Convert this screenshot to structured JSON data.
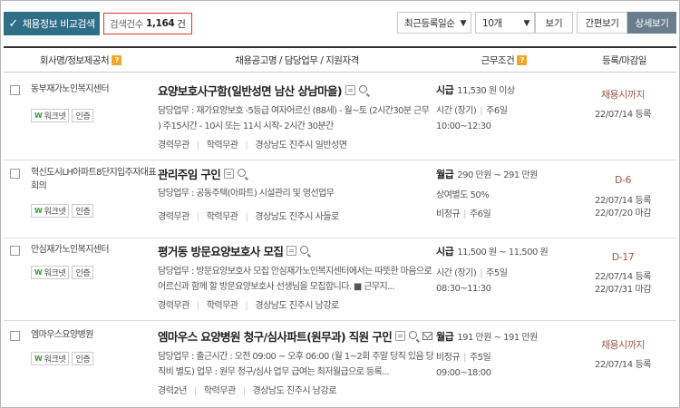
{
  "toolbar": {
    "compare_label": "채용정보 비교검색",
    "count_label": "검색건수",
    "count_value": "1,164",
    "count_unit": "건",
    "sort_select": "최근등록일순",
    "size_select": "10개",
    "view_label": "보기",
    "mode_simple": "간편보기",
    "mode_detail": "상세보기"
  },
  "header": {
    "company": "회사명/정보제공처",
    "title": "채용공고명 / 담당업무 / 지원자격",
    "conditions": "근무조건",
    "date": "등록/마감일"
  },
  "rows": [
    {
      "company": "동부재가노인복지센터",
      "badges": [
        "워크넷",
        "인증"
      ],
      "title": "요양보호사구함(일반성면 남산 상남마을)",
      "desc": "담당업무 : 재가요양보호 -5등급 여자어르신 (88세) - 월~토 (2시간30분 근무 ) 주15시간 - 10시 또는 11시 시작- 2시간 30분간",
      "meta": [
        "경력무관",
        "학력무관",
        "경상남도 진주시 일반성면"
      ],
      "pay_type": "시급",
      "pay_range": "11,530 원 이상",
      "cond_line2a": "시간 (장기)",
      "cond_line2b": "주6일",
      "cond_line3": "10:00~12:30",
      "deadline": "채용시까지",
      "reg": "22/07/14 등록"
    },
    {
      "company": "혁신도시LH아파트8단지입주자대표회의",
      "badges": [
        "워크넷",
        "인증"
      ],
      "title": "관리주임 구인",
      "desc": "담당업무 : 공동주택(아파트) 시설관리 및 영선업무",
      "meta": [
        "경력무관",
        "학력무관",
        "경상남도 진주시 사들로"
      ],
      "pay_type": "월급",
      "pay_range": "290 만원 ~ 291 만원",
      "cond_line2a": "상여별도 50%",
      "cond_line3a": "비정규",
      "cond_line3b": "주6일",
      "deadline": "D-6",
      "reg": "22/07/14 등록",
      "close": "22/07/20 마감"
    },
    {
      "company": "안심재가노인복지센터",
      "badges": [
        "워크넷",
        "인증"
      ],
      "title": "평거동 방문요양보호사 모집",
      "desc": "담당업무 : 방문요양보호사 모집 안심재가노인복지센터에서는 따뜻한 마음으로 어르신과 함께 할 방문요양보호사 선생님을 모집합니다. ■ 근무지...",
      "meta": [
        "경력무관",
        "학력무관",
        "경상남도 진주시 남강로"
      ],
      "pay_type": "시급",
      "pay_range": "11,500 원 ~ 11,500 원",
      "cond_line2a": "시간 (장기)",
      "cond_line2b": "주5일",
      "cond_line3": "08:30~11:30",
      "deadline": "D-17",
      "reg": "22/07/14 등록",
      "close": "22/07/31 마감"
    },
    {
      "company": "엠마우스요양병원",
      "badges": [
        "워크넷",
        "인증"
      ],
      "title": "엠마우스 요양병원 청구/심사파트(원무과) 직원 구인",
      "desc": "담당업무 : 출근시간 : 오전 09:00 ~ 오후 06:00 (월 1~2회 주말 당직 있음 당직비 별도) 업무 : 원무 청구/심사 업무 급여는 최저월급으로 등록...",
      "meta": [
        "경력2년",
        "학력무관",
        "경상남도 진주시 남강로"
      ],
      "pay_type": "월급",
      "pay_range": "191 만원 ~ 191 만원",
      "cond_line2a": "비정규",
      "cond_line2b": "주5일",
      "cond_line3": "09:00~18:00",
      "deadline": "채용시까지",
      "reg": "22/07/14 등록"
    }
  ]
}
